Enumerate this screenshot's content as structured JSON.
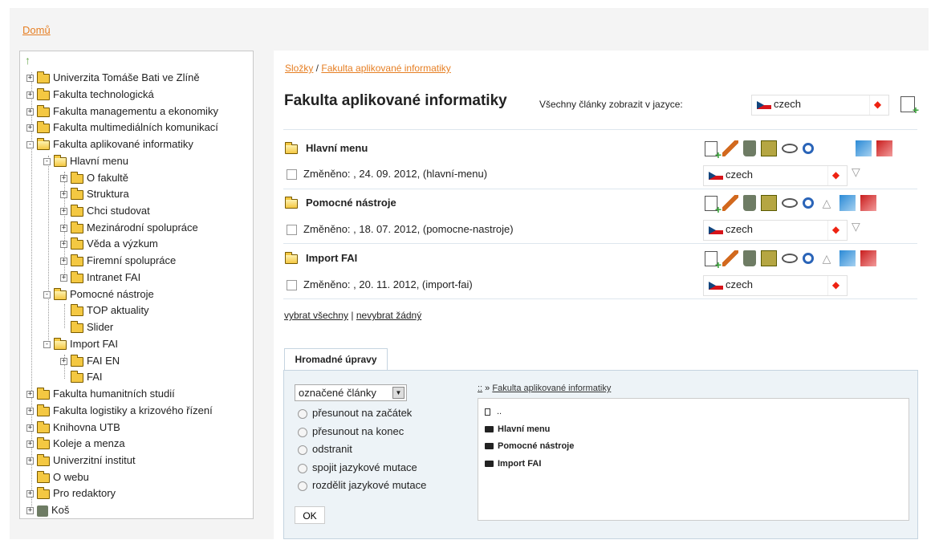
{
  "breadcrumb_home": "Domů",
  "tree": {
    "items": [
      {
        "label": "Univerzita Tomáše Bati ve Zlíně",
        "toggle": "+"
      },
      {
        "label": "Fakulta technologická",
        "toggle": "+"
      },
      {
        "label": "Fakulta managementu a ekonomiky",
        "toggle": "+"
      },
      {
        "label": "Fakulta multimediálních komunikací",
        "toggle": "+"
      },
      {
        "label": "Fakulta aplikované informatiky",
        "toggle": "-"
      },
      {
        "label": "Hlavní menu",
        "toggle": "-"
      },
      {
        "label": "O fakultě",
        "toggle": "+"
      },
      {
        "label": "Struktura",
        "toggle": "+"
      },
      {
        "label": "Chci studovat",
        "toggle": "+"
      },
      {
        "label": "Mezinárodní spolupráce",
        "toggle": "+"
      },
      {
        "label": "Věda a výzkum",
        "toggle": "+"
      },
      {
        "label": "Firemní spolupráce",
        "toggle": "+"
      },
      {
        "label": "Intranet FAI",
        "toggle": "+"
      },
      {
        "label": "Pomocné nástroje",
        "toggle": "-"
      },
      {
        "label": "TOP aktuality",
        "toggle": ""
      },
      {
        "label": "Slider",
        "toggle": ""
      },
      {
        "label": "Import FAI",
        "toggle": "-"
      },
      {
        "label": "FAI EN",
        "toggle": "+"
      },
      {
        "label": "FAI",
        "toggle": ""
      },
      {
        "label": "Fakulta humanitních studií",
        "toggle": "+"
      },
      {
        "label": "Fakulta logistiky a krizového řízení",
        "toggle": "+"
      },
      {
        "label": "Knihovna UTB",
        "toggle": "+"
      },
      {
        "label": "Koleje a menza",
        "toggle": "+"
      },
      {
        "label": "Univerzitní institut",
        "toggle": "+"
      },
      {
        "label": "O webu",
        "toggle": ""
      },
      {
        "label": "Pro redaktory",
        "toggle": "+"
      },
      {
        "label": "Koš",
        "toggle": "+"
      }
    ]
  },
  "main": {
    "crumb_folders": "Složky",
    "crumb_sep": " / ",
    "crumb_current": "Fakulta aplikované informatiky",
    "title": "Fakulta aplikované informatiky",
    "lang_label": "Všechny články zobrazit v jazyce:",
    "lang_value": "czech",
    "sections": [
      {
        "title": "Hlavní menu",
        "changed": "Změněno: , 24. 09. 2012, (hlavní-menu)",
        "lang": "czech"
      },
      {
        "title": "Pomocné nástroje",
        "changed": "Změněno: , 18. 07. 2012, (pomocne-nastroje)",
        "lang": "czech"
      },
      {
        "title": "Import FAI",
        "changed": "Změněno: , 20. 11. 2012, (import-fai)",
        "lang": "czech"
      }
    ],
    "select_all": "vybrat všechny",
    "select_sep": " | ",
    "select_none": "nevybrat žádný"
  },
  "bulk": {
    "tab_label": "Hromadné úpravy",
    "select_value": "označené články",
    "options": [
      "přesunout na začátek",
      "přesunout na konec",
      "odstranit",
      "spojit jazykové mutace",
      "rozdělit jazykové mutace"
    ],
    "ok_label": "OK",
    "target_root": "::",
    "target_sep": " » ",
    "target_current": "Fakulta aplikované informatiky",
    "target_items": [
      "..",
      "Hlavní menu",
      "Pomocné nástroje",
      "Import FAI"
    ]
  }
}
